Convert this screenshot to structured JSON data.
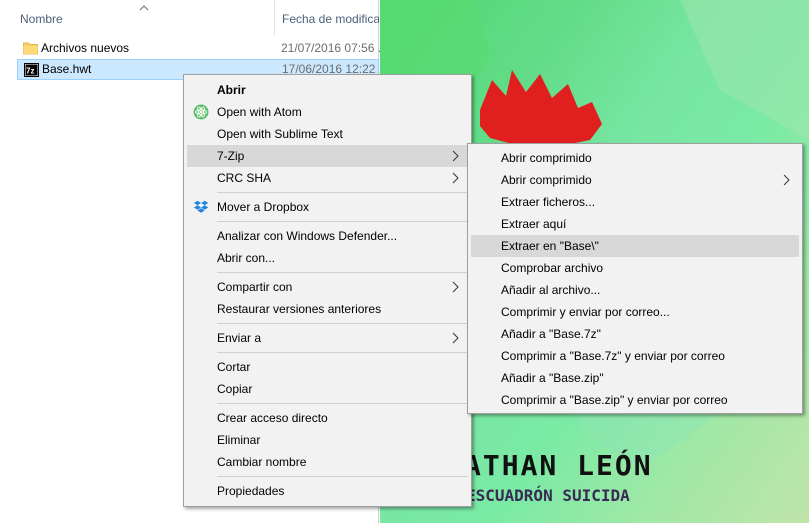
{
  "explorer": {
    "columns": {
      "name": "Nombre",
      "date": "Fecha de modifica"
    },
    "files": [
      {
        "name": "Archivos nuevos",
        "date": "21/07/2016 07:56 ..."
      },
      {
        "name": "Base.hwt",
        "date": "17/06/2016 12:22 ..."
      }
    ]
  },
  "wallpaper": {
    "line1": "ATHAN LEÓN",
    "line2": "ESCUADRÓN SUICIDA"
  },
  "context_menu": {
    "items": {
      "open": "Abrir",
      "open_atom": "Open with Atom",
      "open_sublime": "Open with Sublime Text",
      "seven_zip": "7-Zip",
      "crc_sha": "CRC SHA",
      "dropbox": "Mover a Dropbox",
      "defender": "Analizar con Windows Defender...",
      "open_with": "Abrir con...",
      "share": "Compartir con",
      "restore": "Restaurar versiones anteriores",
      "send_to": "Enviar a",
      "cut": "Cortar",
      "copy": "Copiar",
      "shortcut": "Crear acceso directo",
      "delete": "Eliminar",
      "rename": "Cambiar nombre",
      "properties": "Propiedades"
    }
  },
  "seven_zip_menu": {
    "items": {
      "open_archive": "Abrir comprimido",
      "open_archive_sub": "Abrir comprimido",
      "extract_files": "Extraer ficheros...",
      "extract_here": "Extraer aquí",
      "extract_to": "Extraer en \"Base\\\"",
      "test": "Comprobar archivo",
      "add_archive": "Añadir al archivo...",
      "compress_email": "Comprimir y enviar por correo...",
      "add_7z": "Añadir a \"Base.7z\"",
      "compress_7z_email": "Comprimir a \"Base.7z\" y enviar por correo",
      "add_zip": "Añadir a \"Base.zip\"",
      "compress_zip_email": "Comprimir a \"Base.zip\" y enviar por correo"
    }
  },
  "colors": {
    "selection": "#cce8ff",
    "menu_bg": "#f2f2f2",
    "menu_highlight": "#d8d8d8"
  }
}
